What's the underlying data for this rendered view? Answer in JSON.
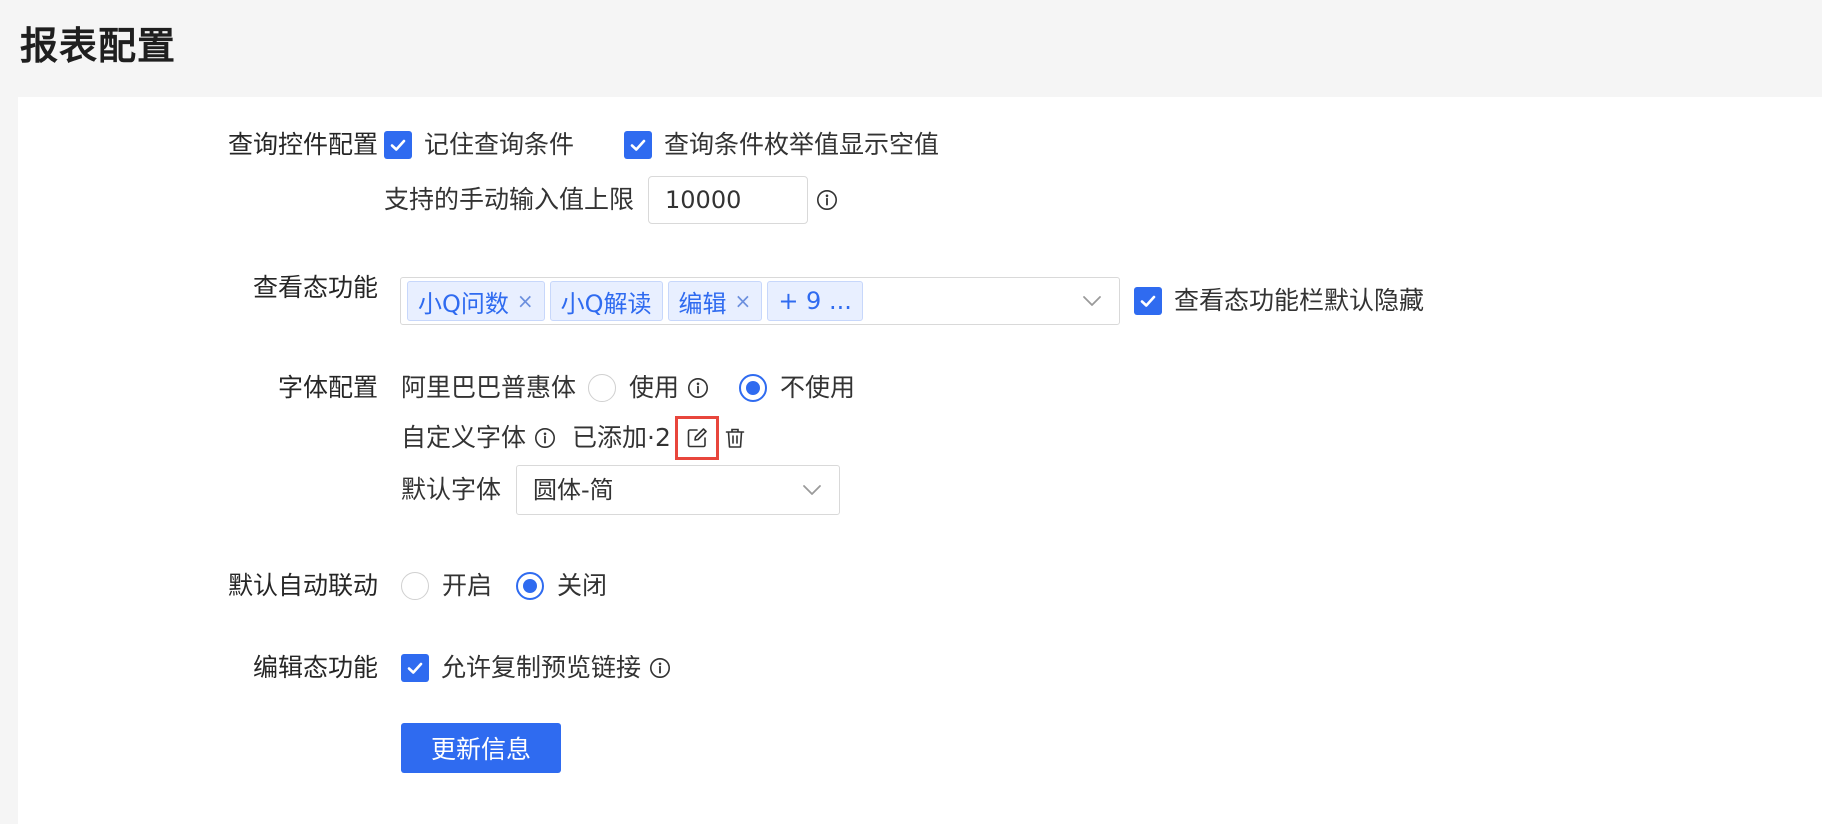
{
  "page": {
    "title": "报表配置"
  },
  "query_control": {
    "label": "查询控件配置",
    "remember_conditions": {
      "label": "记住查询条件",
      "checked": true
    },
    "show_empty_enum": {
      "label": "查询条件枚举值显示空值",
      "checked": true
    },
    "manual_input_limit": {
      "label": "支持的手动输入值上限",
      "value": "10000"
    }
  },
  "view_features": {
    "label": "查看态功能",
    "tags": [
      {
        "label": "小Q问数",
        "closable": true
      },
      {
        "label": "小Q解读",
        "closable": false
      },
      {
        "label": "编辑",
        "closable": true
      },
      {
        "label": "+ 9 ...",
        "closable": false
      }
    ],
    "hide_by_default": {
      "label": "查看态功能栏默认隐藏",
      "checked": true
    }
  },
  "font_config": {
    "label": "字体配置",
    "alibaba_font": {
      "label": "阿里巴巴普惠体",
      "options": [
        {
          "label": "使用",
          "selected": false
        },
        {
          "label": "不使用",
          "selected": true
        }
      ]
    },
    "custom_font": {
      "label": "自定义字体",
      "added_text": "已添加·2"
    },
    "default_font": {
      "label": "默认字体",
      "value": "圆体-简"
    }
  },
  "auto_link": {
    "label": "默认自动联动",
    "options": [
      {
        "label": "开启",
        "selected": false
      },
      {
        "label": "关闭",
        "selected": true
      }
    ]
  },
  "edit_features": {
    "label": "编辑态功能",
    "allow_copy_preview": {
      "label": "允许复制预览链接",
      "checked": true
    }
  },
  "actions": {
    "update_label": "更新信息"
  },
  "colors": {
    "primary": "#2f6bf0",
    "highlight_border": "#e8463c",
    "tag_bg": "#e8efff"
  }
}
